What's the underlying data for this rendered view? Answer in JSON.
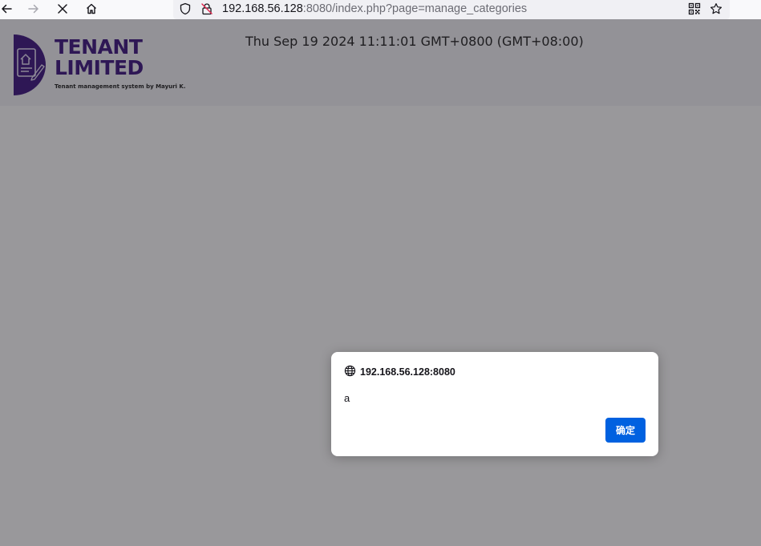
{
  "browser": {
    "url_host": "192.168.56.128",
    "url_rest": ":8080/index.php?page=manage_categories",
    "icons": {
      "back": "back-arrow-icon",
      "forward": "forward-arrow-icon",
      "stop": "stop-loading-icon",
      "home": "home-icon",
      "tracking": "shield-icon",
      "security": "insecure-lock-icon",
      "qr": "qr-code-icon",
      "bookmark": "star-icon"
    }
  },
  "site": {
    "logo_line1": "TENANT",
    "logo_line2": "LIMITED",
    "tagline": "Tenant management system by Mayuri K.",
    "datetime": "Thu Sep 19 2024 11:11:01 GMT+0800 (GMT+08:00)",
    "brand_color": "#3d1580"
  },
  "dialog": {
    "origin": "192.168.56.128:8080",
    "message": "a",
    "ok_label": "确定",
    "button_color": "#0061e0"
  }
}
